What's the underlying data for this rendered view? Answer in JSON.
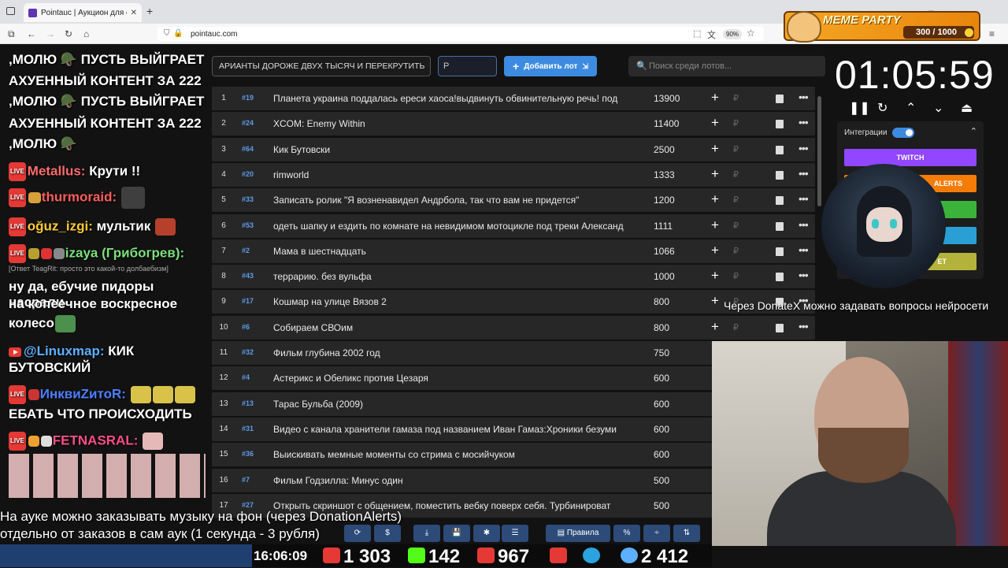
{
  "browser": {
    "tab_title": "Pointauc | Аукцион для стримеров",
    "url": "pointauc.com",
    "zoom": "90%"
  },
  "meme_party": {
    "title": "MEME PARTY",
    "count": "300 / 1000"
  },
  "chat": [
    {
      "text": ",МОЛЮ 🪖 ПУСТЬ ВЫЙГРАЕТ"
    },
    {
      "text": "АХУЕННЫЙ КОНТЕНТ ЗА 222"
    },
    {
      "text": ",МОЛЮ 🪖 ПУСТЬ ВЫЙГРАЕТ"
    },
    {
      "text": "АХУЕННЫЙ КОНТЕНТ ЗА 222"
    },
    {
      "text": ",МОЛЮ 🪖"
    },
    {
      "user": "Metallus:",
      "msg": "Крути !!",
      "user_color": "#ff6b6b"
    },
    {
      "user": "thurmoraid:",
      "msg": "",
      "user_color": "#ff5e5e"
    },
    {
      "user": "oğuz_izgi:",
      "msg": "мультик",
      "user_color": "#ffcc33"
    },
    {
      "user": "izaya (Грибогрев):",
      "msg": "",
      "user_color": "#7be07b"
    },
    {
      "reply": "[Ответ TeagRit: просто это какой-то долбаебизм]"
    },
    {
      "text": "ну да, ебучие пидоры насрали"
    },
    {
      "text": "на копеечное воскресное"
    },
    {
      "text": "колесо"
    },
    {
      "user": "@Linuxmap:",
      "msg": "КИК",
      "user_color": "#5db0ff"
    },
    {
      "text": "БУТОВСКИЙ"
    },
    {
      "user": "ИнквиZитоR:",
      "msg": "",
      "user_color": "#4d7fff"
    },
    {
      "text": "ЕБАТЬ ЧТО ПРОИСХОДИТЬ"
    },
    {
      "user": "FETNASRAL:",
      "msg": "",
      "user_color": "#ff4d8a"
    }
  ],
  "controls": {
    "marquee": "АРИАНТЫ ДОРОЖЕ ДВУХ ТЫСЯЧ И ПЕРЕКРУТИТЬ",
    "cost_value": "Р",
    "add_lot": "Добавить лот",
    "search_placeholder": "Поиск среди лотов..."
  },
  "lots": [
    {
      "n": "1",
      "id": "#19",
      "name": "Планета украина поддалась ереси хаоса!выдвинуть обвинительную речь! под",
      "amount": "13900"
    },
    {
      "n": "2",
      "id": "#24",
      "name": "XCOM: Enemy Within",
      "amount": "11400"
    },
    {
      "n": "3",
      "id": "#64",
      "name": "Кик Бутовски",
      "amount": "2500"
    },
    {
      "n": "4",
      "id": "#20",
      "name": "rimworld",
      "amount": "1333"
    },
    {
      "n": "5",
      "id": "#33",
      "name": "Записать ролик \"Я возненавидел Андрбола, так что вам не придется\"",
      "amount": "1200"
    },
    {
      "n": "6",
      "id": "#53",
      "name": "одеть шапку и ездить по комнате на невидимом мотоцикле под треки Александ",
      "amount": "1111"
    },
    {
      "n": "7",
      "id": "#2",
      "name": "Мама в шестнадцать",
      "amount": "1066"
    },
    {
      "n": "8",
      "id": "#43",
      "name": "террарию. без вульфа",
      "amount": "1000"
    },
    {
      "n": "9",
      "id": "#17",
      "name": "Кошмар на улице Вязов 2",
      "amount": "800"
    },
    {
      "n": "10",
      "id": "#6",
      "name": "Собираем СВОим",
      "amount": "800"
    },
    {
      "n": "11",
      "id": "#32",
      "name": "Фильм глубина 2002 год",
      "amount": "750"
    },
    {
      "n": "12",
      "id": "#4",
      "name": "Астерикс и Обеликс против Цезаря",
      "amount": "600"
    },
    {
      "n": "13",
      "id": "#13",
      "name": "Тарас Бульба (2009)",
      "amount": "600"
    },
    {
      "n": "14",
      "id": "#31",
      "name": "Видео с канала хранители гамаза под названием Иван Гамаз:Хроники безуми",
      "amount": "600"
    },
    {
      "n": "15",
      "id": "#36",
      "name": "Выискивать мемные моменты со стрима с мосийчуком",
      "amount": "600"
    },
    {
      "n": "16",
      "id": "#7",
      "name": "Фильм Годзилла: Минус один",
      "amount": "500"
    },
    {
      "n": "17",
      "id": "#27",
      "name": "Открыть скриншот с общением, поместить вебку поверх себя. Турбинироват",
      "amount": "500"
    }
  ],
  "timer": {
    "value": "01:05:59"
  },
  "integrations": {
    "label": "Интеграции",
    "twitch": "TWITCH",
    "alerts": "ALERTS",
    "set": "ET"
  },
  "overlay": {
    "donatex": "Через DonateX можно задавать вопросы нейросети",
    "music_line1": "На ауке можно заказывать музыку на фон (через DonationAlerts)",
    "music_line2": "отдельно от заказов в сам аук (1 секунда - 3 рубля)",
    "rules_button": "Правила"
  },
  "stats": {
    "clock": "16:06:09",
    "youtube": "1 303",
    "kick": "142",
    "vk": "967",
    "viewers": "2 412"
  },
  "colors": {
    "accent": "#3d8be0",
    "bg": "#121212",
    "row": "#272727"
  }
}
